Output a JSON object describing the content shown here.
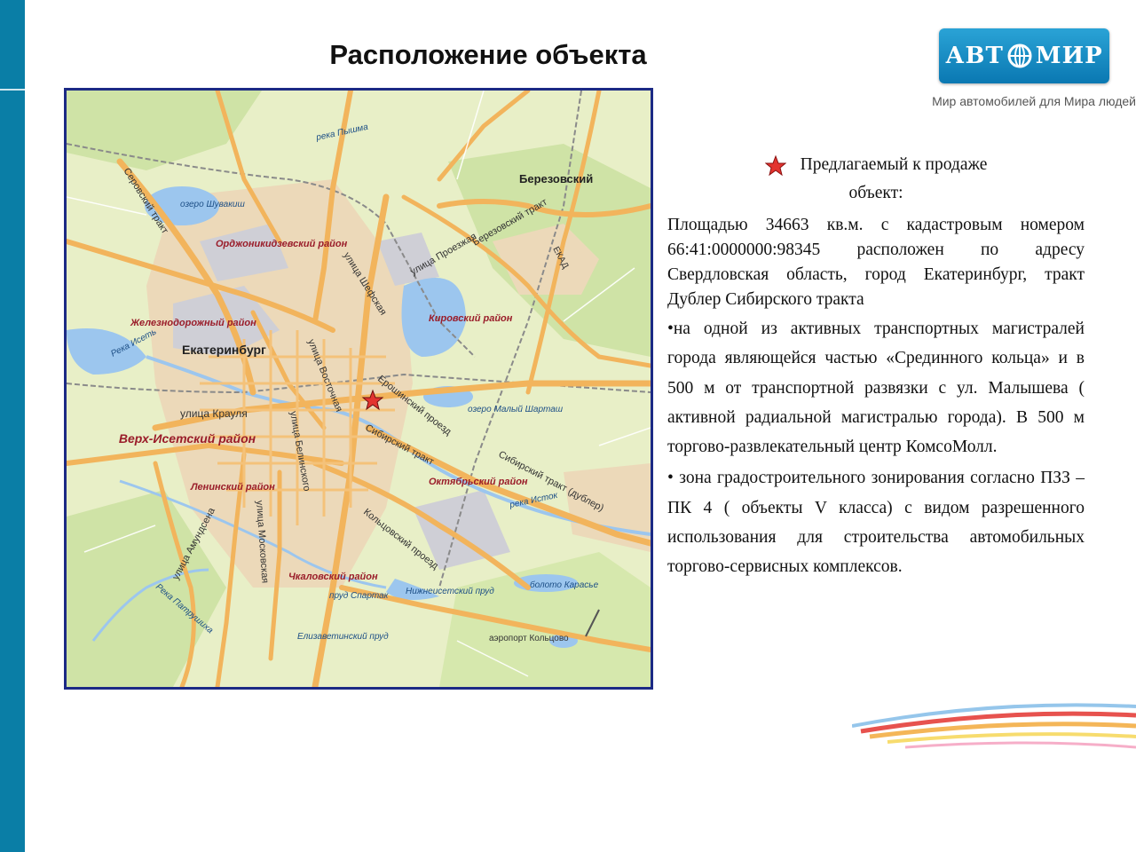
{
  "page": {
    "title": "Расположение объекта"
  },
  "logo": {
    "text_left": "АВТ",
    "text_right": "МИР",
    "tagline": "Мир автомобилей для Мира людей"
  },
  "map": {
    "labels": {
      "city": "Екатеринбург",
      "berezovsky": "Березовский",
      "ordzhonikidze": "Орджоникидзевский район",
      "zheleznodorozhny": "Железнодорожный район",
      "kirovsky": "Кировский район",
      "verkh_isetsky": "Верх-Исетский район",
      "leninsky": "Ленинский район",
      "oktyabrsky": "Октябрьский район",
      "chkalovsky": "Чкаловский район",
      "ozero_shuvakish": "озеро Шувакиш",
      "ozero_maly_shartash": "озеро Малый Шарташ",
      "reka_pyshma": "река Пышма",
      "reka_iset": "Река Исеть",
      "reka_istok": "река Исток",
      "reka_patrushikha": "Река Патрушиха",
      "bereza_trakt": "Березовский тракт",
      "serov_trakt": "Серовский тракт",
      "ul_proezzhaya": "улица Проезжая",
      "ul_shefskaya": "улица Шефская",
      "ul_vostochnaya": "улица Восточная",
      "ul_krauly": "улица Крауля",
      "ul_belinskogo": "улица Белинского",
      "ul_amundsena": "улица Амундсена",
      "ul_moskovskaya": "улица Московская",
      "eroshinsky": "Ерошинский проезд",
      "sib_trakt": "Сибирский тракт",
      "sib_trakt_dubler": "Сибирский тракт (дублер)",
      "koltsovsky": "Кольцовский проезд",
      "ekad": "ЕКАД",
      "prud_spartak": "пруд Спартак",
      "nizhneisetsky": "Нижнеисетский пруд",
      "elizavetinsky": "Елизаветинский пруд",
      "boloto": "болото Карасье",
      "airport": "аэропорт Кольцово"
    }
  },
  "legend": {
    "line1": "Предлагаемый к продаже",
    "line2": "объект:"
  },
  "description": {
    "paragraph": "Площадью 34663 кв.м. с кадастровым номером 66:41:0000000:98345 расположен по адресу Свердловская область, город Екатеринбург, тракт Дублер Сибирского тракта",
    "bullet1": "•на одной из активных транспортных магистралей города являющейся частью «Срединного кольца» и в 500 м от транспортной развязки с ул. Малышева ( активной радиальной магистралью города). В 500 м торгово-развлекательный центр КомсоМолл.",
    "bullet2": "• зона градостроительного зонирования согласно ПЗЗ – ПК 4 ( объекты V класса) с видом разрешенного использования для строительства автомобильных торгово-сервисных комплексов."
  },
  "colors": {
    "sidebar": "#0a7ea6",
    "map_border": "#1c2a85",
    "road": "#f2b45c",
    "water": "#9cc6ee",
    "district_label": "#9a1d2a",
    "star": "#e3342f"
  }
}
